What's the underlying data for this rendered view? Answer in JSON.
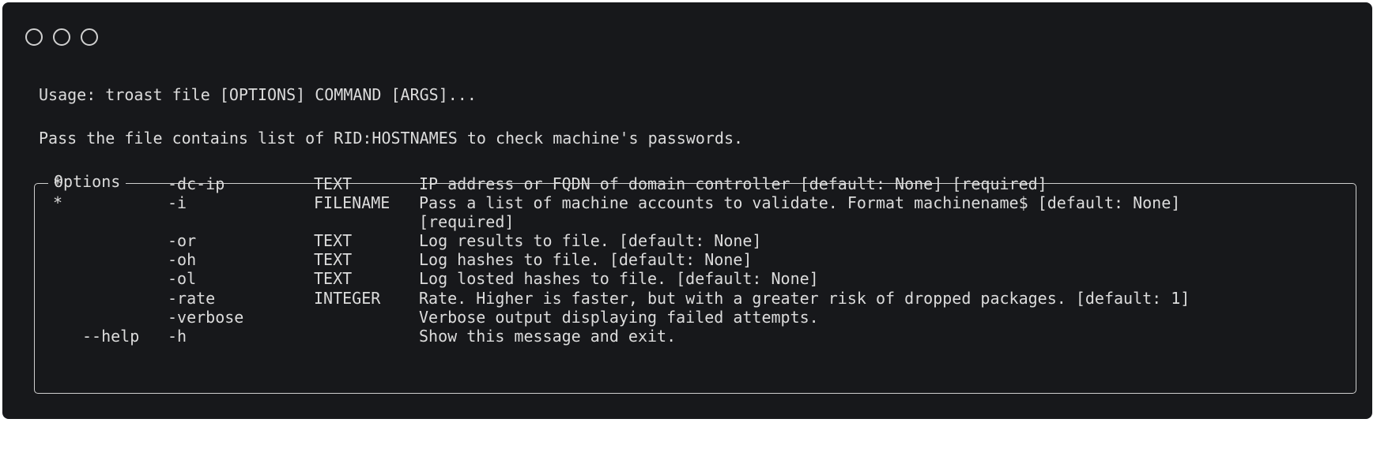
{
  "window": {
    "controls": [
      "circle",
      "circle",
      "circle"
    ]
  },
  "usage": "Usage: troast file [OPTIONS] COMMAND [ARGS]...",
  "description": "Pass the file contains list of RID:HOSTNAMES to check machine's passwords.",
  "options": {
    "title": "Options",
    "rows": [
      {
        "required": "*",
        "long": "",
        "flag": "-dc-ip",
        "type": "TEXT",
        "desc": "IP address or FQDN of domain controller [default: None] [required]",
        "desc2": ""
      },
      {
        "required": "*",
        "long": "",
        "flag": "-i",
        "type": "FILENAME",
        "desc": "Pass a list of machine accounts to validate. Format machinename$ [default: None]",
        "desc2": "[required]"
      },
      {
        "required": "",
        "long": "",
        "flag": "-or",
        "type": "TEXT",
        "desc": "Log results to file. [default: None]",
        "desc2": ""
      },
      {
        "required": "",
        "long": "",
        "flag": "-oh",
        "type": "TEXT",
        "desc": "Log hashes to file. [default: None]",
        "desc2": ""
      },
      {
        "required": "",
        "long": "",
        "flag": "-ol",
        "type": "TEXT",
        "desc": "Log losted hashes to file. [default: None]",
        "desc2": ""
      },
      {
        "required": "",
        "long": "",
        "flag": "-rate",
        "type": "INTEGER",
        "desc": "Rate. Higher is faster, but with a greater risk of dropped packages. [default: 1]",
        "desc2": ""
      },
      {
        "required": "",
        "long": "",
        "flag": "-verbose",
        "type": "",
        "desc": "Verbose output displaying failed attempts.",
        "desc2": ""
      },
      {
        "required": "",
        "long": "--help",
        "flag": "-h",
        "type": "",
        "desc": "Show this message and exit.",
        "desc2": ""
      }
    ]
  },
  "colors": {
    "background": "#17181b",
    "text": "#dcdcdc",
    "border": "#cfcfcf"
  }
}
